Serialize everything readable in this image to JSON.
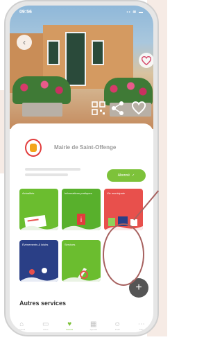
{
  "status_bar": {
    "time": "09:56",
    "icons": "▪▪ ≋ ▬"
  },
  "hero": {
    "back_icon": "chevron-left-icon",
    "actions": [
      "qr-code-icon",
      "share-icon",
      "heart-icon"
    ]
  },
  "header": {
    "mairie_name": "Mairie de Saint-Offenge",
    "follow_label": "Abonné"
  },
  "tiles": [
    {
      "title": "Actualités",
      "color": "#6bbd2f"
    },
    {
      "title": "Informations pratiques",
      "color": "#58b02c"
    },
    {
      "title": "Vie municipale",
      "color": "#e8504c"
    },
    {
      "title": "Évènements & loisirs",
      "color": "#2a3f86"
    },
    {
      "title": "Services",
      "color": "#6bbd2f"
    }
  ],
  "section": {
    "title": "Autres services"
  },
  "navbar": [
    {
      "label": "Accueil",
      "icon": "home-icon"
    },
    {
      "label": "Actus",
      "icon": "news-icon"
    },
    {
      "label": "Favoris",
      "icon": "heart-icon"
    },
    {
      "label": "Agenda",
      "icon": "calendar-icon"
    },
    {
      "label": "Profil",
      "icon": "user-icon"
    },
    {
      "label": "Plus",
      "icon": "more-icon"
    }
  ],
  "fab": {
    "icon": "plus-icon"
  },
  "colors": {
    "accent": "#7dc23a",
    "highlight_ring": "#a7615f"
  }
}
